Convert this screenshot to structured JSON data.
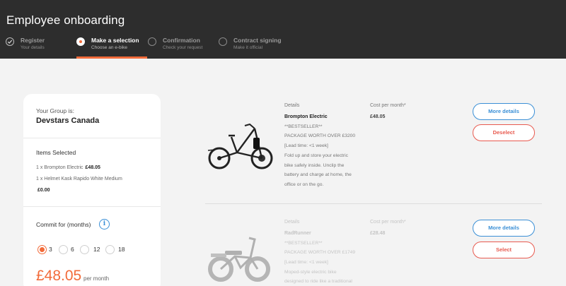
{
  "header": {
    "title": "Employee onboarding",
    "steps": [
      {
        "name": "Register",
        "sub": "Your details",
        "state": "done"
      },
      {
        "name": "Make a selection",
        "sub": "Choose an e-bike",
        "state": "active"
      },
      {
        "name": "Confirmation",
        "sub": "Check your request",
        "state": "pending"
      },
      {
        "name": "Contract signing",
        "sub": "Make it official",
        "state": "pending"
      }
    ]
  },
  "summary": {
    "group_label": "Your Group is:",
    "group_name": "Devstars Canada",
    "items_title": "Items Selected",
    "items": [
      {
        "text": "1 x Brompton Electric",
        "price": "£48.05"
      },
      {
        "text": "1 x Helmet Kask Rapido White Medium",
        "price": ""
      }
    ],
    "helmet_price": "£0.00",
    "commit_title": "Commit for (months)",
    "months": [
      "3",
      "6",
      "12",
      "18"
    ],
    "selected_month": "3",
    "price": "£48.05",
    "per_month": "per month"
  },
  "products": [
    {
      "details_label": "Details",
      "name": "Brompton Electric",
      "lines": [
        "**BESTSELLER**",
        "PACKAGE WORTH OVER £3200",
        "[Lead time: <1 week]",
        "Fold up and store your electric",
        "bike safely inside. Unclip the",
        "battery and charge at home, the",
        "office or on the go."
      ],
      "cost_label": "Cost per month*",
      "cost": "£48.05",
      "more_label": "More details",
      "action_label": "Deselect"
    },
    {
      "details_label": "Details",
      "name": "RadRunner",
      "lines": [
        "**BESTSELLER**",
        "PACKAGE WORTH OVER £1749",
        "[Lead time: <1 week]",
        "Moped-style electric bike",
        "designed to ride like a traditional"
      ],
      "cost_label": "Cost per month*",
      "cost": "£28.48",
      "more_label": "More details",
      "action_label": "Select"
    }
  ],
  "colors": {
    "accent": "#f26b3a",
    "link_blue": "#3a8fd6",
    "danger": "#e85a4f",
    "header_bg": "#2d2d2d"
  }
}
